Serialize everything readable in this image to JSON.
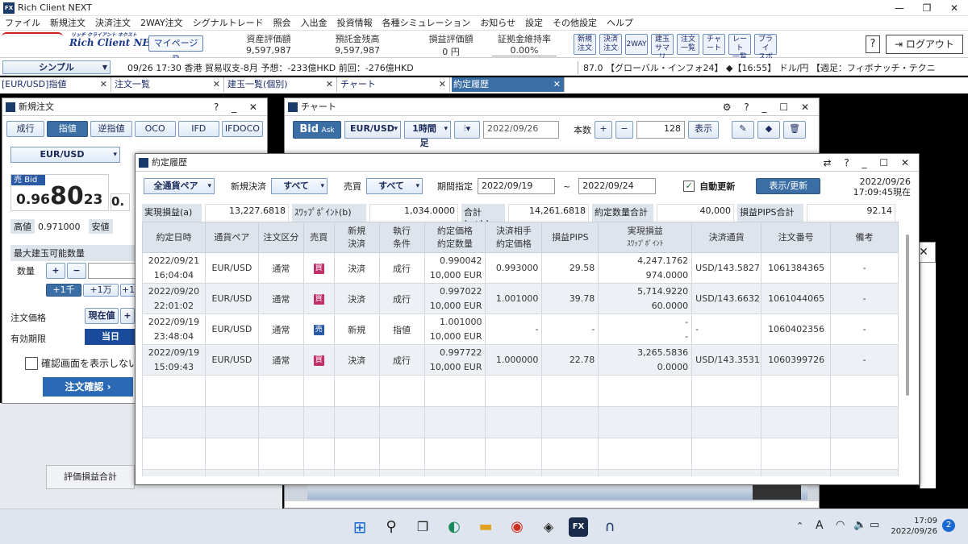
{
  "app": {
    "title": "Rich Client NEXT",
    "brand": "Rich Client NEXT",
    "brand_tag": "リッチ クライアント ネクスト",
    "menu": [
      "ファイル",
      "新規注文",
      "決済注文",
      "2WAY注文",
      "シグナルトレード",
      "照会",
      "入出金",
      "投資情報",
      "各種シミュレーション",
      "お知らせ",
      "設定",
      "その他設定",
      "ヘルプ"
    ]
  },
  "header": {
    "mypage": "マイページ ⧉",
    "account": [
      {
        "label": "資産評価額",
        "value": "9,597,987 円"
      },
      {
        "label": "預託金残高",
        "value": "9,597,987 円"
      },
      {
        "label": "損益評価額",
        "value": "0 円"
      },
      {
        "label": "証拠金維持率",
        "value": "0.00%"
      }
    ],
    "buttons": [
      {
        "l1": "新規",
        "l2": "注文"
      },
      {
        "l1": "決済",
        "l2": "注文"
      },
      {
        "l1": "2WAY",
        "l2": ""
      },
      {
        "l1": "建玉",
        "l2": "サマリ"
      },
      {
        "l1": "注文",
        "l2": "一覧"
      },
      {
        "l1": "チャ",
        "l2": "ート"
      },
      {
        "l1": "レート",
        "l2": "一覧"
      },
      {
        "l1": "プライ",
        "l2": "スボ"
      }
    ],
    "help": "?",
    "logout": "ログアウト"
  },
  "tickerbar": {
    "mode": "シンプル",
    "left": "09/26 17:30 香港 貿易収支-8月 予想：-233億HKD 前回：-276億HKD",
    "right": "87.0 【グローバル・インフォ24】 ◆【16:55】 ドル/円 【週足：フィボナッチ・テクニ"
  },
  "tabs": [
    {
      "label": "[EUR/USD]指値",
      "active": false
    },
    {
      "label": "注文一覧",
      "active": false
    },
    {
      "label": "建玉一覧(個別)",
      "active": false
    },
    {
      "label": "チャート",
      "active": false
    },
    {
      "label": "約定履歴",
      "active": true
    }
  ],
  "new_order": {
    "title": "新規注文",
    "types": [
      "成行",
      "指値",
      "逆指値",
      "OCO",
      "IFD",
      "IFDOCO"
    ],
    "pair": "EUR/USD",
    "side": "売",
    "bid": "Bid",
    "price_small": "0.96",
    "price_big": "80",
    "price_sub": "23",
    "high_label": "高値",
    "high_value": "0.971000",
    "low_label": "安値",
    "max_qty": "最大建玉可能数量",
    "qty_label": "数量",
    "quick": [
      "+1千",
      "+1万",
      "+1"
    ],
    "price_label": "注文価格",
    "price_type": "現在値",
    "expiry_label": "有効期限",
    "expiry": "当日",
    "confirm_check": "確認画面を表示しない",
    "confirm_btn": "注文確認"
  },
  "chart_win": {
    "title": "チャート",
    "bid": "Bid",
    "ask": "Ask",
    "pair": "EUR/USD",
    "period": "1時間足",
    "date": "2022/09/26",
    "count_label": "本数",
    "count": "128",
    "show": "表示"
  },
  "fills": {
    "title": "約定履歴",
    "pair_filter": "全通貨ペア",
    "settle_label": "新規決済",
    "settle": "すべて",
    "side_label": "売買",
    "side": "すべて",
    "period_label": "期間指定",
    "from": "2022/09/19",
    "to": "2022/09/24",
    "tilde": "~",
    "auto_update": "自動更新",
    "refresh_btn": "表示/更新",
    "stamp_date": "2022/09/26",
    "stamp_time": "17:09:45現在",
    "summary": [
      {
        "label": "実現損益(a)",
        "value": "13,227.6818"
      },
      {
        "label": "ｽﾜｯﾌﾟﾎﾟｲﾝﾄ(b)",
        "value": "1,034.0000"
      },
      {
        "label": "合計(a+b)",
        "value": "14,261.6818"
      },
      {
        "label": "約定数量合計",
        "value": "40,000"
      },
      {
        "label": "損益PIPS合計",
        "value": "92.14"
      }
    ],
    "headers": [
      [
        "約定日時"
      ],
      [
        "通貨ペア"
      ],
      [
        "注文区分"
      ],
      [
        "売買"
      ],
      [
        "新規",
        "決済"
      ],
      [
        "執行",
        "条件"
      ],
      [
        "約定価格",
        "約定数量"
      ],
      [
        "決済相手",
        "約定価格"
      ],
      [
        "損益PIPS"
      ],
      [
        "実現損益",
        "ｽﾜｯﾌﾟﾎﾟｲﾝﾄ"
      ],
      [
        "決済通貨"
      ],
      [
        "注文番号"
      ],
      [
        "備考"
      ]
    ],
    "rows": [
      {
        "date": "2022/09/21",
        "time": "16:04:04",
        "pair": "EUR/USD",
        "type": "通常",
        "side": "買",
        "side_kind": "buy",
        "settle": "決済",
        "exec": "成行",
        "price": "0.990042",
        "qty": "10,000 EUR",
        "counter": "0.993000",
        "pips": "29.58",
        "pl": "4,247.1762",
        "swap": "974.0000",
        "ccy": "USD/143.5827",
        "no": "1061384365",
        "note": "-"
      },
      {
        "date": "2022/09/20",
        "time": "22:01:02",
        "pair": "EUR/USD",
        "type": "通常",
        "side": "買",
        "side_kind": "buy",
        "settle": "決済",
        "exec": "成行",
        "price": "0.997022",
        "qty": "10,000 EUR",
        "counter": "1.001000",
        "pips": "39.78",
        "pl": "5,714.9220",
        "swap": "60.0000",
        "ccy": "USD/143.6632",
        "no": "1061044065",
        "note": "-"
      },
      {
        "date": "2022/09/19",
        "time": "23:48:04",
        "pair": "EUR/USD",
        "type": "通常",
        "side": "売",
        "side_kind": "sell",
        "settle": "新規",
        "exec": "指値",
        "price": "1.001000",
        "qty": "10,000 EUR",
        "counter": "-",
        "pips": "-",
        "pl": "-",
        "swap": "-",
        "ccy": "-",
        "no": "1060402356",
        "note": "-"
      },
      {
        "date": "2022/09/19",
        "time": "15:09:43",
        "pair": "EUR/USD",
        "type": "通常",
        "side": "買",
        "side_kind": "buy",
        "settle": "決済",
        "exec": "成行",
        "price": "0.997722",
        "qty": "10,000 EUR",
        "counter": "1.000000",
        "pips": "22.78",
        "pl": "3,265.5836",
        "swap": "0.0000",
        "ccy": "USD/143.3531",
        "no": "1060399726",
        "note": "-"
      }
    ]
  },
  "background_text": {
    "eval_total": "評価損益合計"
  },
  "taskbar": {
    "time": "17:09",
    "date": "2022/09/26",
    "ime": "A",
    "badge": "2"
  }
}
